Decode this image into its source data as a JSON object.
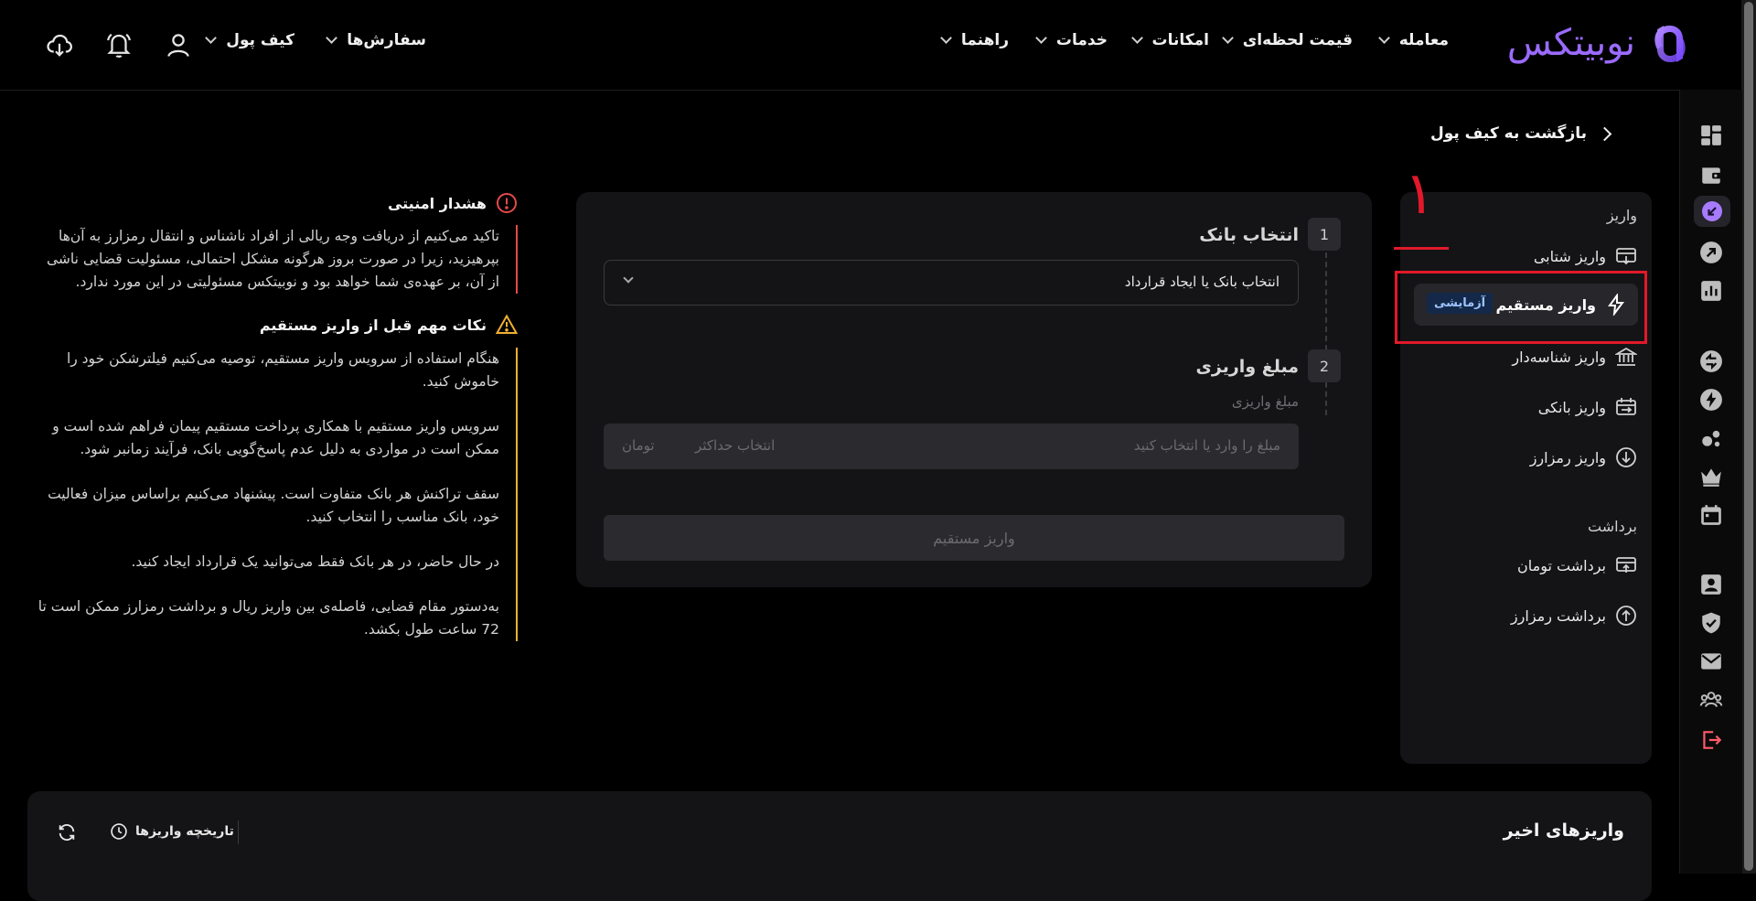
{
  "brand": {
    "name": "نوبیتکس",
    "accent": "#9b6bff"
  },
  "header": {
    "nav": [
      {
        "label": "معامله"
      },
      {
        "label": "قیمت لحظه‌ای"
      },
      {
        "label": "امکانات"
      },
      {
        "label": "خدمات"
      },
      {
        "label": "راهنما"
      }
    ],
    "user_nav": [
      {
        "label": "سفارش‌ها"
      },
      {
        "label": "کیف پول"
      }
    ],
    "icons": [
      "user-icon",
      "bell-icon",
      "download-cloud-icon"
    ]
  },
  "back_link": {
    "label": "بازگشت به کیف پول"
  },
  "menu": {
    "deposit_heading": "واریز",
    "deposit_items": [
      {
        "label": "واریز شتابی",
        "icon": "card-deposit-icon"
      },
      {
        "label": "واریز مستقیم",
        "icon": "lightning-icon",
        "badge": "آزمایشی",
        "active": true
      },
      {
        "label": "واریز شناسه‌دار",
        "icon": "bank-icon"
      },
      {
        "label": "واریز بانکی",
        "icon": "bank-transfer-icon"
      },
      {
        "label": "واریز رمزارز",
        "icon": "crypto-down-icon"
      }
    ],
    "withdraw_heading": "برداشت",
    "withdraw_items": [
      {
        "label": "برداشت تومان",
        "icon": "card-withdraw-icon"
      },
      {
        "label": "برداشت رمزارز",
        "icon": "crypto-up-icon"
      }
    ]
  },
  "annotation": {
    "number": "۱",
    "color": "#e1192a"
  },
  "form": {
    "step1": {
      "number": "1",
      "title": "انتخاب بانک",
      "select_value": "انتخاب بانک یا ایجاد قرارداد"
    },
    "step2": {
      "number": "2",
      "title": "مبلغ واریزی",
      "sublabel": "مبلغ واریزی",
      "placeholder": "مبلغ را وارد یا انتخاب کنید",
      "max_label": "انتخاب حداکثر",
      "unit": "تومان"
    },
    "submit_label": "واریز مستقیم"
  },
  "security": {
    "title": "هشدار امنیتی",
    "color": "#e34a4a",
    "text": "تاکید می‌کنیم از دریافت وجه ریالی از افراد ناشناس و انتقال رمزارز به آن‌ها بپرهیزید، زیرا در صورت بروز هرگونه مشکل احتمالی، مسئولیت قضایی ناشی از آن، بر عهده‌ی شما خواهد بود و نوبیتکس مسئولیتی در این مورد ندارد."
  },
  "notes": {
    "title": "نکات مهم قبل از واریز مستقیم",
    "color": "#f0b030",
    "items": [
      "هنگام استفاده از سرویس واریز مستقیم، توصیه می‌کنیم فیلترشکن خود را خاموش کنید.",
      "سرویس واریز مستقیم با همکاری پرداخت مستقیم پیمان فراهم شده است و ممکن است در مواردی به دلیل عدم پاسخ‌گویی بانک، فرآیند زمانبر شود.",
      "سقف تراکنش هر بانک متفاوت است. پیشنهاد می‌کنیم براساس میزان فعالیت خود، بانک مناسب را انتخاب کنید.",
      "در حال حاضر، در هر بانک فقط می‌توانید یک قرارداد ایجاد کنید.",
      "به‌دستور مقام قضایی، فاصله‌ی بین واریز ریال و برداشت رمزارز ممکن است تا 72 ساعت طول بکشد."
    ]
  },
  "recent": {
    "title": "واریزهای اخیر",
    "history_label": "تاریخچه واریزها"
  }
}
